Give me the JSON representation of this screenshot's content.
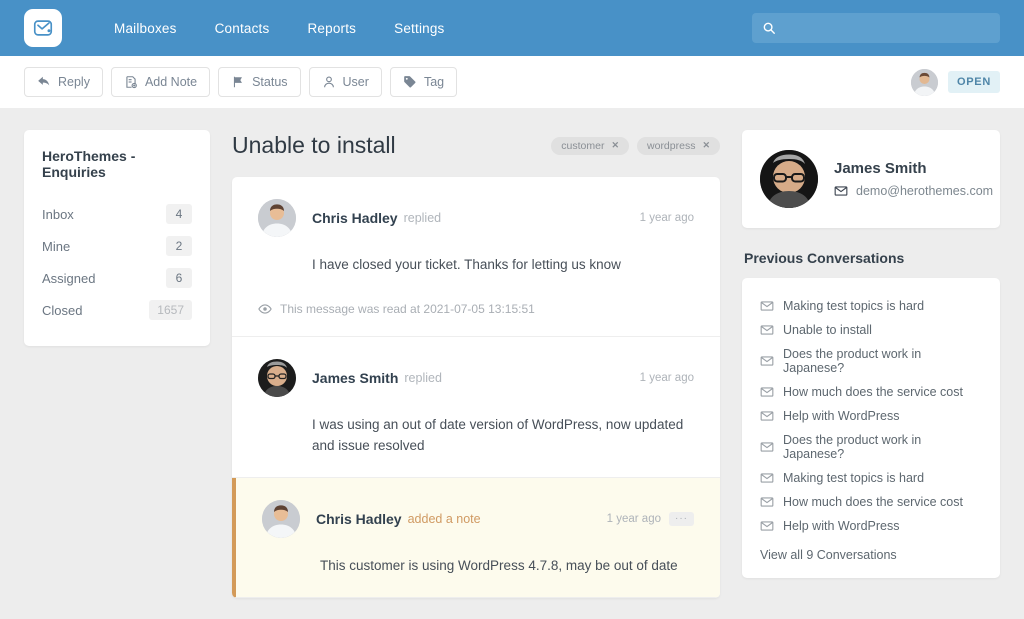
{
  "header": {
    "logo_icon": "envelope-check-icon",
    "nav": [
      {
        "label": "Mailboxes"
      },
      {
        "label": "Contacts"
      },
      {
        "label": "Reports"
      },
      {
        "label": "Settings"
      }
    ],
    "search": {
      "value": "",
      "placeholder": "",
      "icon": "search-icon"
    }
  },
  "toolbar": {
    "buttons": [
      {
        "label": "Reply",
        "icon": "reply-arrow-icon"
      },
      {
        "label": "Add Note",
        "icon": "note-plus-icon"
      },
      {
        "label": "Status",
        "icon": "flag-icon"
      },
      {
        "label": "User",
        "icon": "user-icon"
      },
      {
        "label": "Tag",
        "icon": "tag-icon"
      }
    ],
    "status_badge": "OPEN",
    "assignee_avatar": "chris-hadley-avatar"
  },
  "sidebar": {
    "title": "HeroThemes - Enquiries",
    "items": [
      {
        "label": "Inbox",
        "count": "4"
      },
      {
        "label": "Mine",
        "count": "2"
      },
      {
        "label": "Assigned",
        "count": "6"
      },
      {
        "label": "Closed",
        "count": "1657"
      }
    ]
  },
  "conversation": {
    "title": "Unable to install",
    "tags": [
      {
        "label": "customer",
        "remove": "✕"
      },
      {
        "label": "wordpress",
        "remove": "✕"
      }
    ],
    "messages": [
      {
        "author": "Chris Hadley",
        "action": "replied",
        "time": "1 year ago",
        "body": "I have closed your ticket. Thanks for letting us know",
        "meta": "This message was read at 2021-07-05 13:15:51",
        "type": "reply"
      },
      {
        "author": "James Smith",
        "action": "replied",
        "time": "1 year ago",
        "body": "I was using an out of date version of WordPress, now updated and issue resolved",
        "type": "reply"
      },
      {
        "author": "Chris Hadley",
        "action": "added a note",
        "time": "1 year ago",
        "body": "This customer is using WordPress 4.7.8, may be out of date",
        "menu": "···",
        "type": "note"
      }
    ]
  },
  "customer": {
    "name": "James Smith",
    "email": "demo@herothemes.com",
    "email_icon": "envelope-icon"
  },
  "previous": {
    "heading": "Previous Conversations",
    "items": [
      {
        "label": "Making test topics is hard"
      },
      {
        "label": "Unable to install"
      },
      {
        "label": "Does the product work in Japanese?"
      },
      {
        "label": "How much does the service cost"
      },
      {
        "label": "Help with WordPress"
      },
      {
        "label": "Does the product work in Japanese?"
      },
      {
        "label": "Making test topics is hard"
      },
      {
        "label": "How much does the service cost"
      },
      {
        "label": "Help with WordPress"
      }
    ],
    "view_all": "View all 9 Conversations"
  },
  "colors": {
    "brand_blue": "#4891c7",
    "note_bg": "#fdfbed",
    "note_border": "#d39a58",
    "badge_bg": "#e2f1f6",
    "badge_text": "#4f86a8"
  }
}
